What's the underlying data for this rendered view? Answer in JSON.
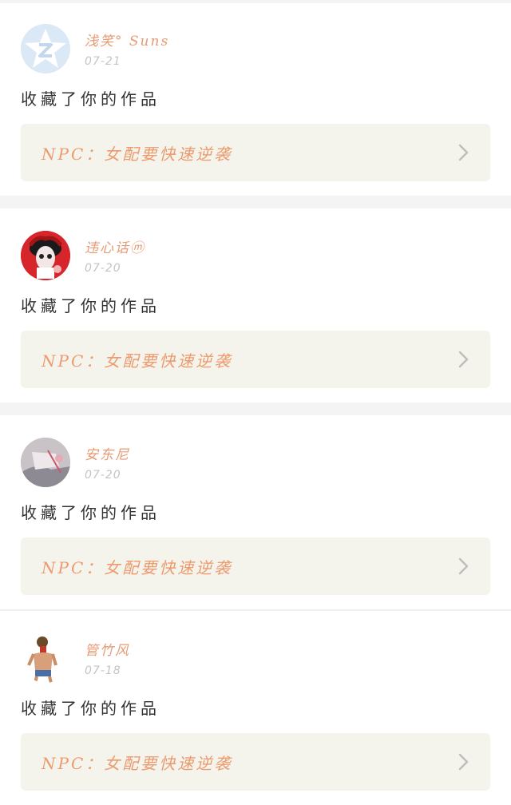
{
  "feed": {
    "items": [
      {
        "username": "浅笑° Suns",
        "date": "07-21",
        "action": "收藏了你的作品",
        "work_title": "NPC：女配要快速逆袭",
        "avatar_icon": "qq-zone-star-icon",
        "avatar_color": "#dbe9f7"
      },
      {
        "username": "违心话ⓜ",
        "date": "07-20",
        "action": "收藏了你的作品",
        "work_title": "NPC：女配要快速逆袭",
        "avatar_icon": "anime-girl-avatar",
        "avatar_color": "#d6262c"
      },
      {
        "username": "安东尼",
        "date": "07-20",
        "action": "收藏了你的作品",
        "work_title": "NPC：女配要快速逆袭",
        "avatar_icon": "photo-avatar",
        "avatar_color": "#b9b0b8"
      },
      {
        "username": "管竹风",
        "date": "07-18",
        "action": "收藏了你的作品",
        "work_title": "NPC：女配要快速逆袭",
        "avatar_icon": "man-figure-avatar",
        "avatar_color": "#ffffff"
      }
    ]
  },
  "colors": {
    "accent": "#ec9a6e",
    "date": "#c4c4c4",
    "link_bg": "#f5f4ec"
  }
}
